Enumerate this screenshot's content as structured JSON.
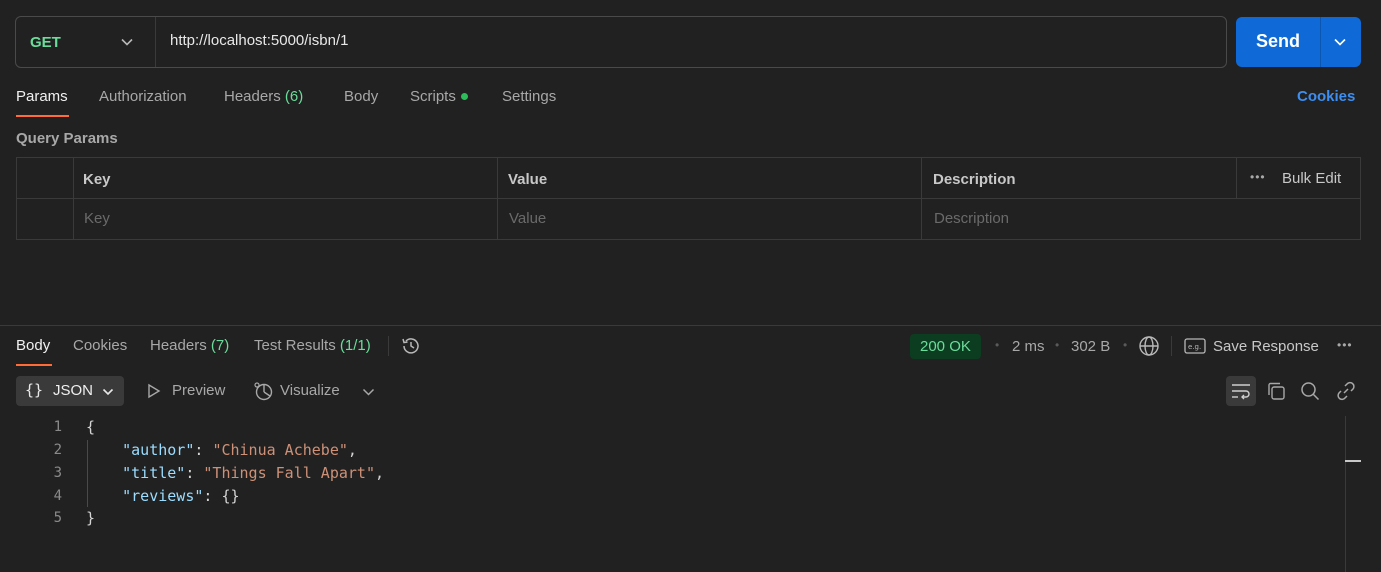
{
  "request": {
    "method": "GET",
    "url": "http://localhost:5000/isbn/1",
    "send_label": "Send"
  },
  "request_tabs": {
    "params": "Params",
    "authorization": "Authorization",
    "headers": "Headers",
    "headers_count": "(6)",
    "body": "Body",
    "scripts": "Scripts",
    "settings": "Settings",
    "cookies": "Cookies"
  },
  "query_params": {
    "title": "Query Params",
    "columns": [
      "Key",
      "Value",
      "Description"
    ],
    "bulk_edit": "Bulk Edit",
    "placeholders": [
      "Key",
      "Value",
      "Description"
    ]
  },
  "response_tabs": {
    "body": "Body",
    "cookies": "Cookies",
    "headers": "Headers",
    "headers_count": "(7)",
    "test_results": "Test Results",
    "test_results_count": "(1/1)"
  },
  "response_meta": {
    "status": "200 OK",
    "time": "2 ms",
    "size": "302 B",
    "save_response": "Save Response"
  },
  "body_toolbar": {
    "format": "JSON",
    "preview": "Preview",
    "visualize": "Visualize"
  },
  "response_body": {
    "lines": [
      {
        "n": "1",
        "text": "{"
      },
      {
        "n": "2",
        "key": "\"author\"",
        "value": "\"Chinua Achebe\"",
        "trail": ","
      },
      {
        "n": "3",
        "key": "\"title\"",
        "value": "\"Things Fall Apart\"",
        "trail": ","
      },
      {
        "n": "4",
        "key": "\"reviews\"",
        "value": "{}",
        "trail": ""
      },
      {
        "n": "5",
        "text": "}"
      }
    ]
  },
  "colors": {
    "accent_blue": "#0f6ad8",
    "tab_underline": "#ff6c37",
    "status_green": "#6bdd9a",
    "method_green": "#6bdd9a"
  },
  "icons": [
    "chevron-down-icon",
    "history-icon",
    "globe-icon",
    "save-icon",
    "more-icon",
    "preview-icon",
    "visualize-icon",
    "wrap-icon",
    "copy-icon",
    "search-icon",
    "link-icon"
  ]
}
